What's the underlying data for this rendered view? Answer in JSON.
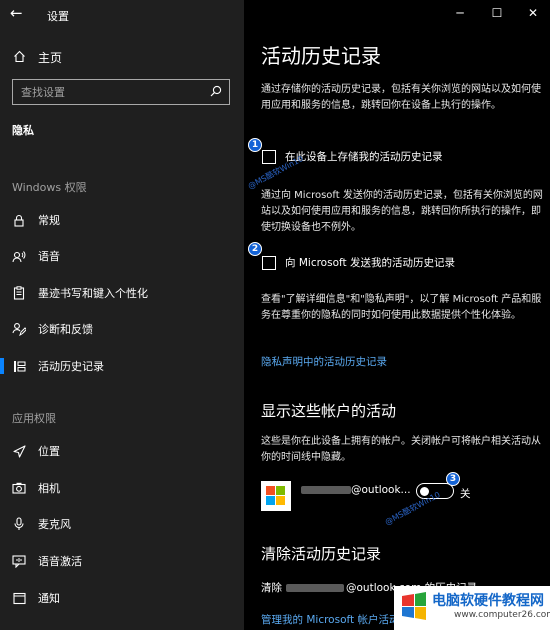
{
  "app": {
    "title": "设置"
  },
  "nav": {
    "home_label": "主页",
    "search_placeholder": "查找设置",
    "category": "隐私",
    "windows_group_title": "Windows 权限",
    "windows_items": [
      {
        "label": "常规",
        "icon": "lock-icon"
      },
      {
        "label": "语音",
        "icon": "speech-icon"
      },
      {
        "label": "墨迹书写和键入个性化",
        "icon": "clipboard-pen-icon"
      },
      {
        "label": "诊断和反馈",
        "icon": "feedback-icon"
      },
      {
        "label": "活动历史记录",
        "icon": "timeline-icon",
        "active": true
      }
    ],
    "app_group_title": "应用权限",
    "app_items": [
      {
        "label": "位置",
        "icon": "location-icon"
      },
      {
        "label": "相机",
        "icon": "camera-icon"
      },
      {
        "label": "麦克风",
        "icon": "microphone-icon"
      },
      {
        "label": "语音激活",
        "icon": "voice-activation-icon"
      },
      {
        "label": "通知",
        "icon": "notification-icon"
      }
    ]
  },
  "main": {
    "title": "活动历史记录",
    "intro": "通过存储你的活动历史记录，包括有关你浏览的网站以及如何使用应用和服务的信息，跳转回你在设备上执行的操作。",
    "checkbox_store": {
      "label": "在此设备上存储我的活动历史记录",
      "checked": false
    },
    "send_desc": "通过向 Microsoft 发送你的活动历史记录，包括有关你浏览的网站以及如何使用应用和服务的信息，跳转回你所执行的操作，即使切换设备也不例外。",
    "checkbox_send": {
      "label": "向 Microsoft 发送我的活动历史记录",
      "checked": false
    },
    "privacy_desc": "查看\"了解详细信息\"和\"隐私声明\"，以了解 Microsoft 产品和服务在尊重你的隐私的同时如何使用此数据提供个性化体验。",
    "privacy_link": "隐私声明中的活动历史记录",
    "accounts_heading": "显示这些帐户的活动",
    "accounts_desc": "这些是你在此设备上拥有的帐户。关闭帐户可将帐户相关活动从你的时间线中隐藏。",
    "account": {
      "email_suffix": "@outlook...",
      "toggle_state": "关",
      "toggle_on": false
    },
    "clear_heading": "清除活动历史记录",
    "clear_prefix": "清除",
    "clear_suffix": "@outlook.com 的历史记录",
    "manage_link": "管理我的 Microsoft 帐户活动"
  },
  "annotations": {
    "badges": [
      "1",
      "2",
      "3"
    ],
    "watermark_text": "@MS酷软Win10"
  },
  "site_logo": {
    "brand": "电脑软硬件教程网",
    "url": "www.computer26.com"
  },
  "colors": {
    "accent": "#0a84ff",
    "link": "#5aa9f0",
    "sidebar_bg": "#1f1f1f",
    "main_bg": "#000000",
    "badge": "#1463d6"
  }
}
